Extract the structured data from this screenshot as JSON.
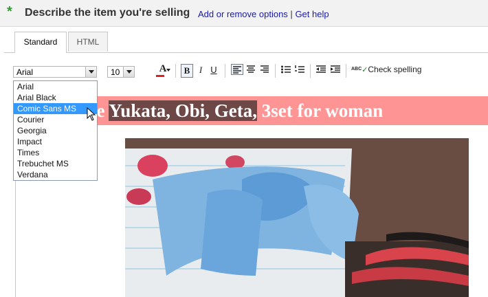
{
  "header": {
    "required_mark": "*",
    "title": "Describe the item you're selling",
    "add_remove_label": "Add or remove options",
    "separator": "|",
    "help_label": "Get help"
  },
  "tabs": [
    {
      "label": "Standard",
      "active": true
    },
    {
      "label": "HTML",
      "active": false
    }
  ],
  "toolbar": {
    "font_value": "Arial",
    "size_value": "10",
    "text_color_label": "A",
    "bold_label": "B",
    "italic_label": "I",
    "underline_label": "U",
    "spell_label": "Check spelling",
    "spell_icon_label": "ABC"
  },
  "font_dropdown": {
    "options": [
      "Arial",
      "Arial Black",
      "Comic Sans MS",
      "Courier",
      "Georgia",
      "Impact",
      "Times",
      "Trebuchet MS",
      "Verdana"
    ],
    "selected_index": 2
  },
  "content": {
    "banner_prefix": "ese ",
    "banner_highlight": "Yukata, Obi, Geta,",
    "banner_suffix": " 3set for woman",
    "banner_color": "#ff9494",
    "highlight_color": "#6e4846"
  },
  "colors": {
    "accent_link": "#1a1aa6",
    "required": "#2e9e2e",
    "selection": "#3399ff"
  }
}
